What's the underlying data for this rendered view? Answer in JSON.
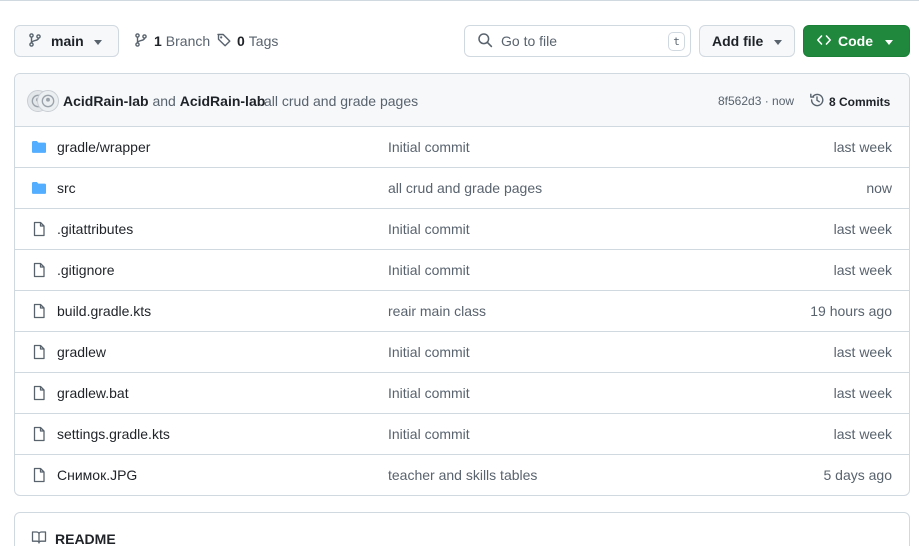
{
  "toolbar": {
    "branch": {
      "icon": "git-branch-icon",
      "label": "main"
    },
    "branches": {
      "count": "1",
      "label": "Branch",
      "icon": "git-branch-icon"
    },
    "tags": {
      "count": "0",
      "label": "Tags",
      "icon": "tag-icon"
    },
    "search": {
      "placeholder": "Go to file",
      "shortcut": "t",
      "icon": "search-icon"
    },
    "add_file": {
      "label": "Add file"
    },
    "code": {
      "label": "Code",
      "icon": "code-icon",
      "color": "#1f883d"
    }
  },
  "latest_commit": {
    "author_1": "AcidRain-lab",
    "joiner": "and",
    "author_2": "AcidRain-lab",
    "message": "all crud and grade pages",
    "sha_time": "8f562d3 · now",
    "commits_label": "8 Commits",
    "history_icon": "history-icon"
  },
  "files": [
    {
      "type": "folder",
      "name": "gradle/wrapper",
      "message": "Initial commit",
      "date": "last week"
    },
    {
      "type": "folder",
      "name": "src",
      "message": "all crud and grade pages",
      "date": "now"
    },
    {
      "type": "file",
      "name": ".gitattributes",
      "message": "Initial commit",
      "date": "last week"
    },
    {
      "type": "file",
      "name": ".gitignore",
      "message": "Initial commit",
      "date": "last week"
    },
    {
      "type": "file",
      "name": "build.gradle.kts",
      "message": "reair main class",
      "date": "19 hours ago"
    },
    {
      "type": "file",
      "name": "gradlew",
      "message": "Initial commit",
      "date": "last week"
    },
    {
      "type": "file",
      "name": "gradlew.bat",
      "message": "Initial commit",
      "date": "last week"
    },
    {
      "type": "file",
      "name": "settings.gradle.kts",
      "message": "Initial commit",
      "date": "last week"
    },
    {
      "type": "file",
      "name": "Снимок.JPG",
      "message": "teacher and skills tables",
      "date": "5 days ago"
    }
  ],
  "readme": {
    "label": "README",
    "icon": "book-icon"
  },
  "colors": {
    "folder": "#54aeff",
    "accent_green": "#1f883d",
    "muted_text": "#59636e",
    "border": "#d1d9e0"
  }
}
